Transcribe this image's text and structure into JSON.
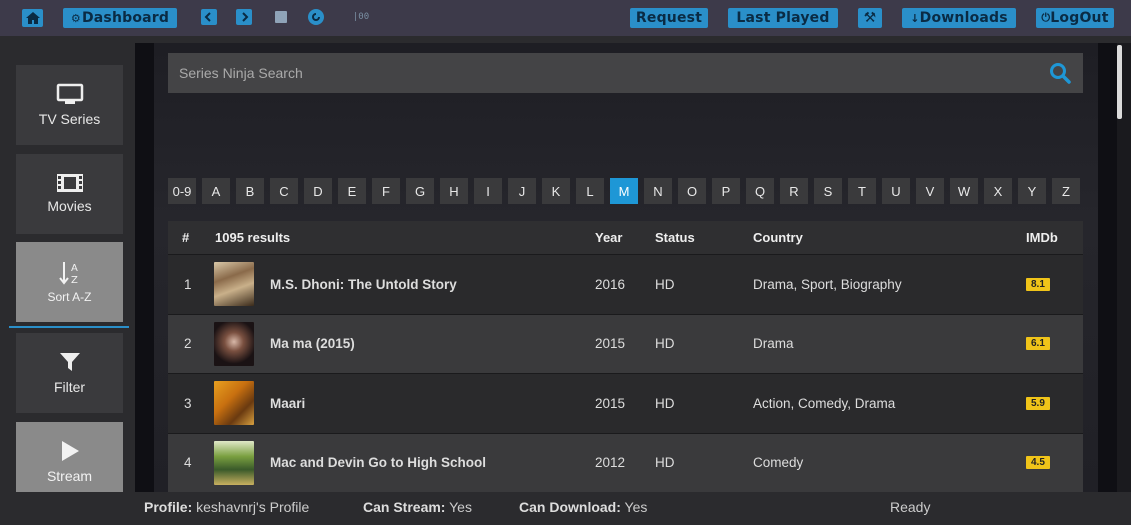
{
  "topbar": {
    "dashboard": "Dashboard",
    "request": "Request",
    "last_played": "Last Played",
    "downloads": "Downloads",
    "logout": "LogOut"
  },
  "sidebar": {
    "tv_series": "TV Series",
    "movies": "Movies",
    "sort_az": "Sort A-Z",
    "filter": "Filter",
    "stream": "Stream"
  },
  "search": {
    "placeholder": "Series Ninja Search"
  },
  "letters": [
    "0-9",
    "A",
    "B",
    "C",
    "D",
    "E",
    "F",
    "G",
    "H",
    "I",
    "J",
    "K",
    "L",
    "M",
    "N",
    "O",
    "P",
    "Q",
    "R",
    "S",
    "T",
    "U",
    "V",
    "W",
    "X",
    "Y",
    "Z"
  ],
  "active_letter": "M",
  "table": {
    "headers": {
      "num": "#",
      "results": "1095 results",
      "year": "Year",
      "status": "Status",
      "country": "Country",
      "imdb": "IMDb"
    },
    "rows": [
      {
        "num": "1",
        "title": "M.S. Dhoni: The Untold Story",
        "year": "2016",
        "status": "HD",
        "country": "Drama, Sport, Biography",
        "imdb": "8.1"
      },
      {
        "num": "2",
        "title": "Ma ma (2015)",
        "year": "2015",
        "status": "HD",
        "country": "Drama",
        "imdb": "6.1"
      },
      {
        "num": "3",
        "title": "Maari",
        "year": "2015",
        "status": "HD",
        "country": "Action, Comedy, Drama",
        "imdb": "5.9"
      },
      {
        "num": "4",
        "title": "Mac and Devin Go to High School",
        "year": "2012",
        "status": "HD",
        "country": "Comedy",
        "imdb": "4.5"
      }
    ]
  },
  "status": {
    "profile_label": "Profile:",
    "profile_value": "keshavnrj's Profile",
    "stream_label": "Can Stream:",
    "stream_value": "Yes",
    "download_label": "Can Download:",
    "download_value": "Yes",
    "ready": "Ready"
  },
  "colors": {
    "accent": "#1e97d6",
    "imdb_badge": "#f0c419"
  }
}
